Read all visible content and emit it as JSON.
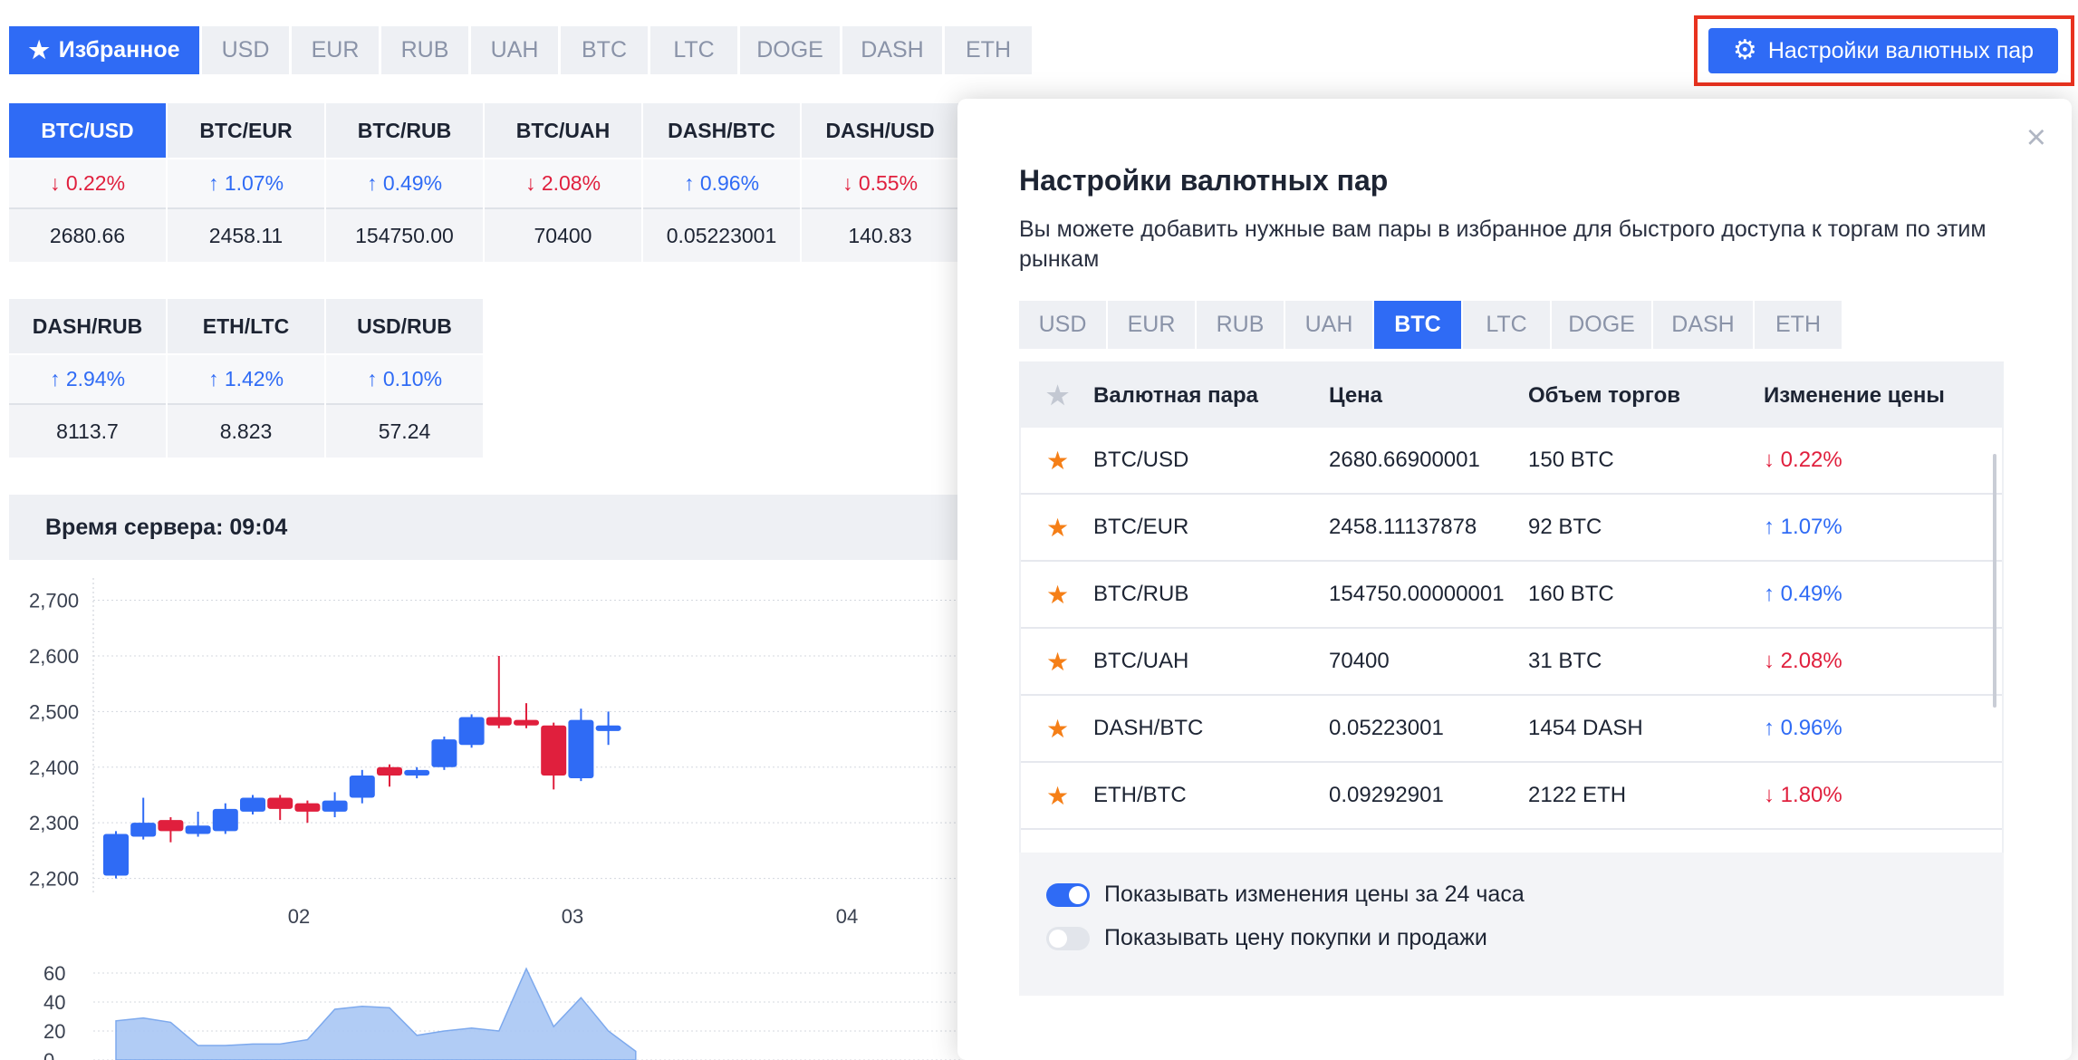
{
  "top_tabs": {
    "favorites_label": "Избранное",
    "items": [
      "USD",
      "EUR",
      "RUB",
      "UAH",
      "BTC",
      "LTC",
      "DOGE",
      "DASH",
      "ETH"
    ]
  },
  "settings_button": {
    "label": "Настройки валютных пар"
  },
  "pair_cards": [
    {
      "pair": "BTC/USD",
      "change": "0.22%",
      "direction": "down",
      "price": "2680.66"
    },
    {
      "pair": "BTC/EUR",
      "change": "1.07%",
      "direction": "up",
      "price": "2458.11"
    },
    {
      "pair": "BTC/RUB",
      "change": "0.49%",
      "direction": "up",
      "price": "154750.00"
    },
    {
      "pair": "BTC/UAH",
      "change": "2.08%",
      "direction": "down",
      "price": "70400"
    },
    {
      "pair": "DASH/BTC",
      "change": "0.96%",
      "direction": "up",
      "price": "0.05223001"
    },
    {
      "pair": "DASH/USD",
      "change": "0.55%",
      "direction": "down",
      "price": "140.83"
    },
    {
      "pair": "DASH/RUB",
      "change": "2.94%",
      "direction": "up",
      "price": "8113.7"
    },
    {
      "pair": "ETH/LTC",
      "change": "1.42%",
      "direction": "up",
      "price": "8.823"
    },
    {
      "pair": "USD/RUB",
      "change": "0.10%",
      "direction": "up",
      "price": "57.24"
    }
  ],
  "server_time": {
    "label": "Время сервера: 09:04"
  },
  "chart_data": {
    "type": "candlestick",
    "y_ticks": [
      "2,700",
      "2,600",
      "2,500",
      "2,400",
      "2,300",
      "2,200"
    ],
    "x_ticks": [
      "02",
      "03",
      "04"
    ],
    "ylim": [
      2170,
      2740
    ],
    "candles": [
      {
        "o": 2205,
        "c": 2280,
        "h": 2285,
        "l": 2200
      },
      {
        "o": 2275,
        "c": 2300,
        "h": 2345,
        "l": 2270
      },
      {
        "o": 2305,
        "c": 2285,
        "h": 2310,
        "l": 2265
      },
      {
        "o": 2280,
        "c": 2295,
        "h": 2320,
        "l": 2275
      },
      {
        "o": 2285,
        "c": 2325,
        "h": 2335,
        "l": 2280
      },
      {
        "o": 2320,
        "c": 2345,
        "h": 2350,
        "l": 2315
      },
      {
        "o": 2345,
        "c": 2325,
        "h": 2350,
        "l": 2305
      },
      {
        "o": 2335,
        "c": 2320,
        "h": 2340,
        "l": 2300
      },
      {
        "o": 2320,
        "c": 2340,
        "h": 2355,
        "l": 2310
      },
      {
        "o": 2345,
        "c": 2385,
        "h": 2395,
        "l": 2335
      },
      {
        "o": 2400,
        "c": 2385,
        "h": 2405,
        "l": 2365
      },
      {
        "o": 2385,
        "c": 2395,
        "h": 2400,
        "l": 2380
      },
      {
        "o": 2400,
        "c": 2450,
        "h": 2455,
        "l": 2395
      },
      {
        "o": 2440,
        "c": 2490,
        "h": 2495,
        "l": 2435
      },
      {
        "o": 2490,
        "c": 2475,
        "h": 2600,
        "l": 2470
      },
      {
        "o": 2485,
        "c": 2475,
        "h": 2515,
        "l": 2470
      },
      {
        "o": 2475,
        "c": 2385,
        "h": 2480,
        "l": 2360
      },
      {
        "o": 2380,
        "c": 2485,
        "h": 2505,
        "l": 2375
      },
      {
        "o": 2465,
        "c": 2475,
        "h": 2500,
        "l": 2440
      }
    ],
    "volume_ticks": [
      "60",
      "40",
      "20",
      "0"
    ],
    "volume": [
      27,
      29,
      26,
      10,
      10,
      11,
      11,
      14,
      35,
      37,
      36,
      17,
      20,
      22,
      20,
      63,
      23,
      43,
      20,
      6
    ]
  },
  "modal": {
    "close_glyph": "×",
    "title": "Настройки валютных пар",
    "description": "Вы можете добавить нужные вам пары в избранное для быстрого доступа к торгам по этим рынкам",
    "tabs": [
      "USD",
      "EUR",
      "RUB",
      "UAH",
      "BTC",
      "LTC",
      "DOGE",
      "DASH",
      "ETH"
    ],
    "active_tab": "BTC",
    "table": {
      "headers": {
        "pair": "Валютная пара",
        "price": "Цена",
        "volume": "Объем торгов",
        "change": "Изменение цены"
      },
      "rows": [
        {
          "pair": "BTC/USD",
          "price": "2680.66900001",
          "volume": "150 BTC",
          "change": "0.22%",
          "direction": "down"
        },
        {
          "pair": "BTC/EUR",
          "price": "2458.11137878",
          "volume": "92 BTC",
          "change": "1.07%",
          "direction": "up"
        },
        {
          "pair": "BTC/RUB",
          "price": "154750.00000001",
          "volume": "160 BTC",
          "change": "0.49%",
          "direction": "up"
        },
        {
          "pair": "BTC/UAH",
          "price": "70400",
          "volume": "31 BTC",
          "change": "2.08%",
          "direction": "down"
        },
        {
          "pair": "DASH/BTC",
          "price": "0.05223001",
          "volume": "1454 DASH",
          "change": "0.96%",
          "direction": "up"
        },
        {
          "pair": "ETH/BTC",
          "price": "0.09292901",
          "volume": "2122 ETH",
          "change": "1.80%",
          "direction": "down"
        }
      ]
    },
    "toggles": [
      {
        "label": "Показывать изменения цены за 24 часа",
        "on": true
      },
      {
        "label": "Показывать цену покупки и продажи",
        "on": false
      }
    ]
  },
  "colors": {
    "accent": "#2f6bf5",
    "up": "#2f6bf5",
    "down": "#e01f3d",
    "star": "#f57f17",
    "highlight": "#e8321f"
  }
}
